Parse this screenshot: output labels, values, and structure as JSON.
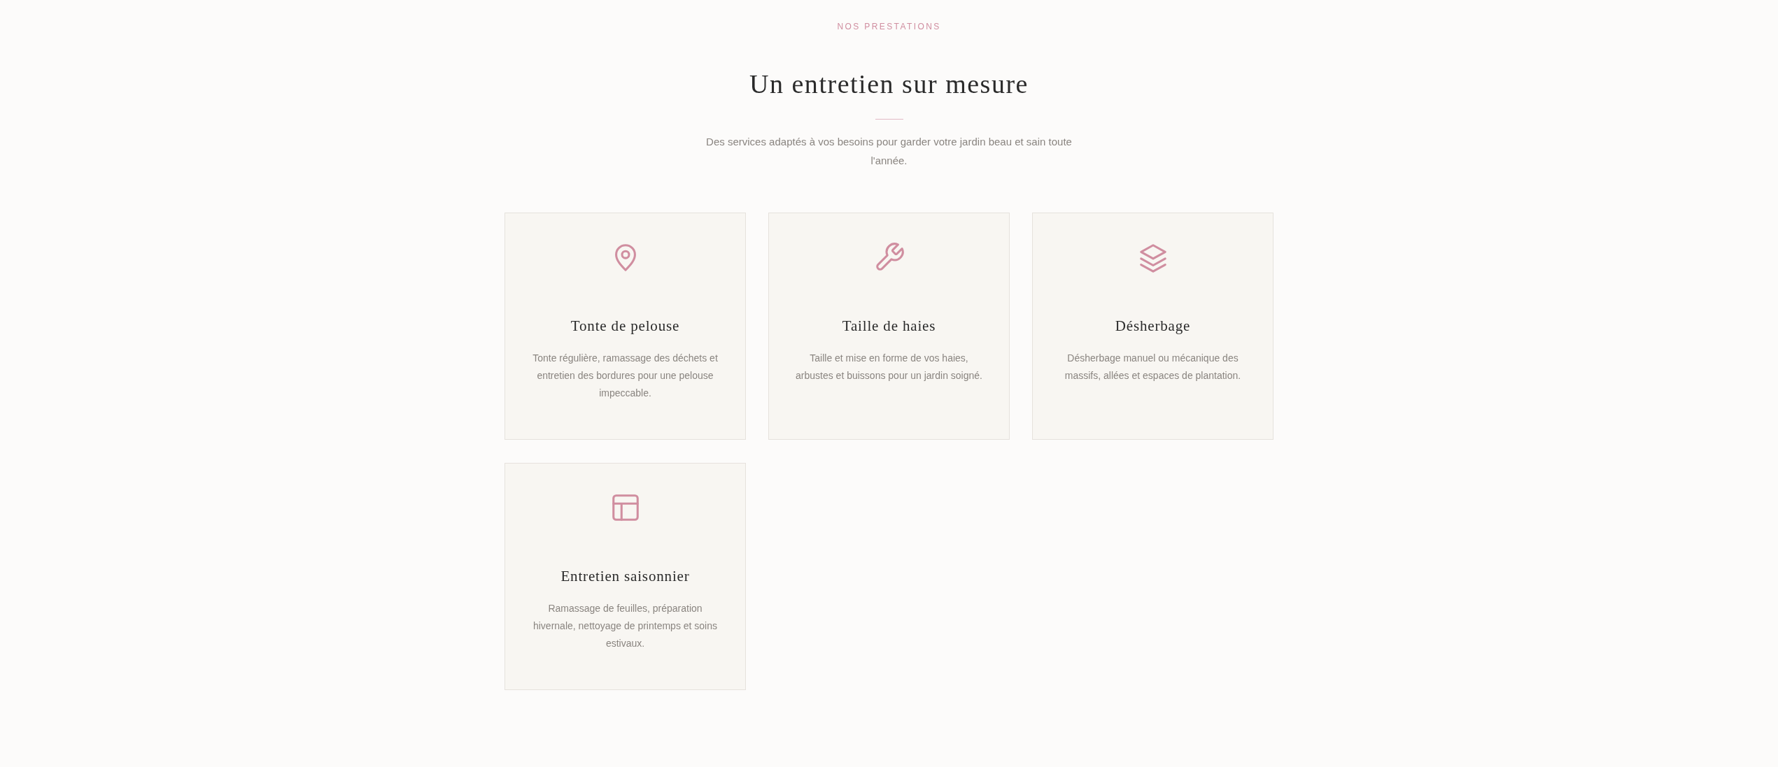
{
  "section": {
    "eyebrow": "NOS PRESTATIONS",
    "title": "Un entretien sur mesure",
    "subtitle": "Des services adaptés à vos besoins pour garder votre jardin beau et sain toute l'année."
  },
  "services": [
    {
      "title": "Tonte de pelouse",
      "description": "Tonte régulière, ramassage des déchets et entretien des bordures pour une pelouse impeccable."
    },
    {
      "title": "Taille de haies",
      "description": "Taille et mise en forme de vos haies, arbustes et buissons pour un jardin soigné."
    },
    {
      "title": "Désherbage",
      "description": "Désherbage manuel ou mécanique des massifs, allées et espaces de plantation."
    },
    {
      "title": "Entretien saisonnier",
      "description": "Ramassage de feuilles, préparation hivernale, nettoyage de printemps et soins estivaux."
    }
  ]
}
